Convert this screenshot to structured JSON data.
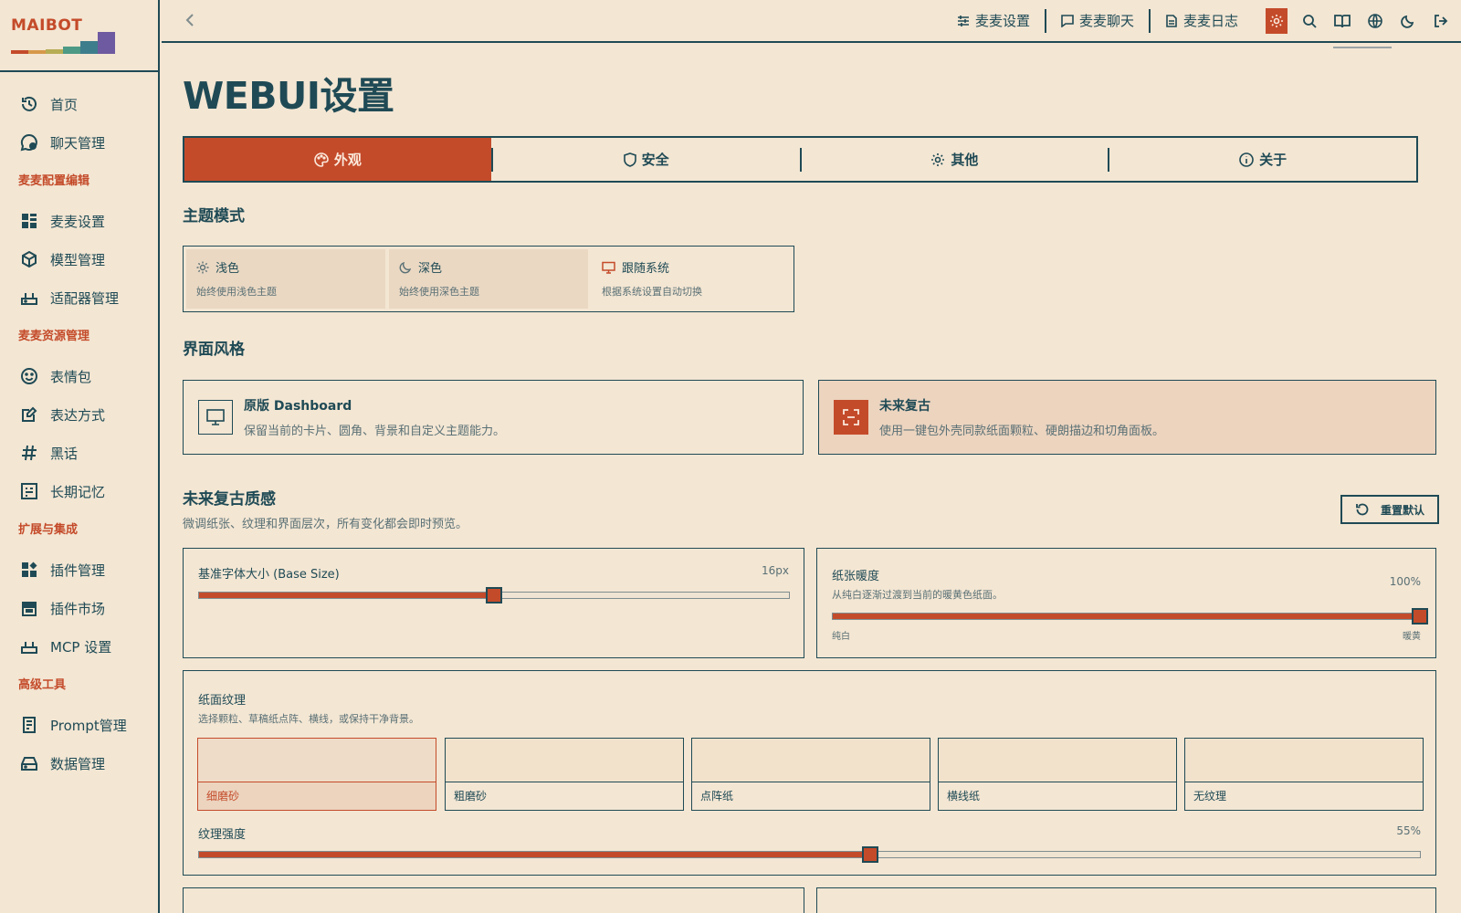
{
  "brand": {
    "name": "MAIBOT",
    "bar_colors": [
      "#c44b2a",
      "#d6994a",
      "#b6ad55",
      "#4d9a86",
      "#3e7d8c",
      "#6e5aa0"
    ]
  },
  "sidebar": {
    "home": "首页",
    "chat_manage": "聊天管理",
    "section_config": "麦麦配置编辑",
    "config_items": [
      "麦麦设置",
      "模型管理",
      "适配器管理"
    ],
    "section_resources": "麦麦资源管理",
    "resource_items": [
      "表情包",
      "表达方式",
      "黑话",
      "长期记忆"
    ],
    "section_ext": "扩展与集成",
    "ext_items": [
      "插件管理",
      "插件市场",
      "MCP 设置"
    ],
    "section_adv": "高级工具",
    "adv_items": [
      "Prompt管理",
      "数据管理"
    ]
  },
  "topbar": {
    "links": [
      "麦麦设置",
      "麦麦聊天",
      "麦麦日志"
    ]
  },
  "page": {
    "title": "WEBUI设置",
    "tabs": [
      "外观",
      "安全",
      "其他",
      "关于"
    ],
    "active_tab": "外观"
  },
  "theme": {
    "heading": "主题模式",
    "options": [
      {
        "title": "浅色",
        "desc": "始终使用浅色主题"
      },
      {
        "title": "深色",
        "desc": "始终使用深色主题"
      },
      {
        "title": "跟随系统",
        "desc": "根据系统设置自动切换"
      }
    ],
    "selected": "跟随系统"
  },
  "style": {
    "heading": "界面风格",
    "cards": [
      {
        "title": "原版 Dashboard",
        "desc": "保留当前的卡片、圆角、背景和自定义主题能力。"
      },
      {
        "title": "未来复古",
        "desc": "使用一键包外壳同款纸面颗粒、硬朗描边和切角面板。"
      }
    ],
    "selected": "未来复古"
  },
  "texture_section": {
    "heading": "未来复古质感",
    "desc": "微调纸张、纹理和界面层次，所有变化都会即时预览。",
    "reset_label": "重置默认"
  },
  "base_size": {
    "title": "基准字体大小 (Base Size)",
    "value_text": "16px",
    "fraction": 0.5
  },
  "warmth": {
    "title": "纸张暖度",
    "desc": "从纯白逐渐过渡到当前的暖黄色纸面。",
    "value_text": "100%",
    "fraction": 1.0,
    "min_label": "纯白",
    "max_label": "暖黄"
  },
  "paper_texture": {
    "title": "纸面纹理",
    "desc": "选择颗粒、草稿纸点阵、横线，或保持干净背景。",
    "options": [
      "细磨砂",
      "粗磨砂",
      "点阵纸",
      "横线纸",
      "无纹理"
    ],
    "selected": "细磨砂",
    "strength_label": "纹理强度",
    "strength_text": "55%",
    "strength_fraction": 0.55
  },
  "colors": {
    "accent": "#c44b2a",
    "ink": "#1f4a55",
    "paper": "#f3e6d3"
  }
}
